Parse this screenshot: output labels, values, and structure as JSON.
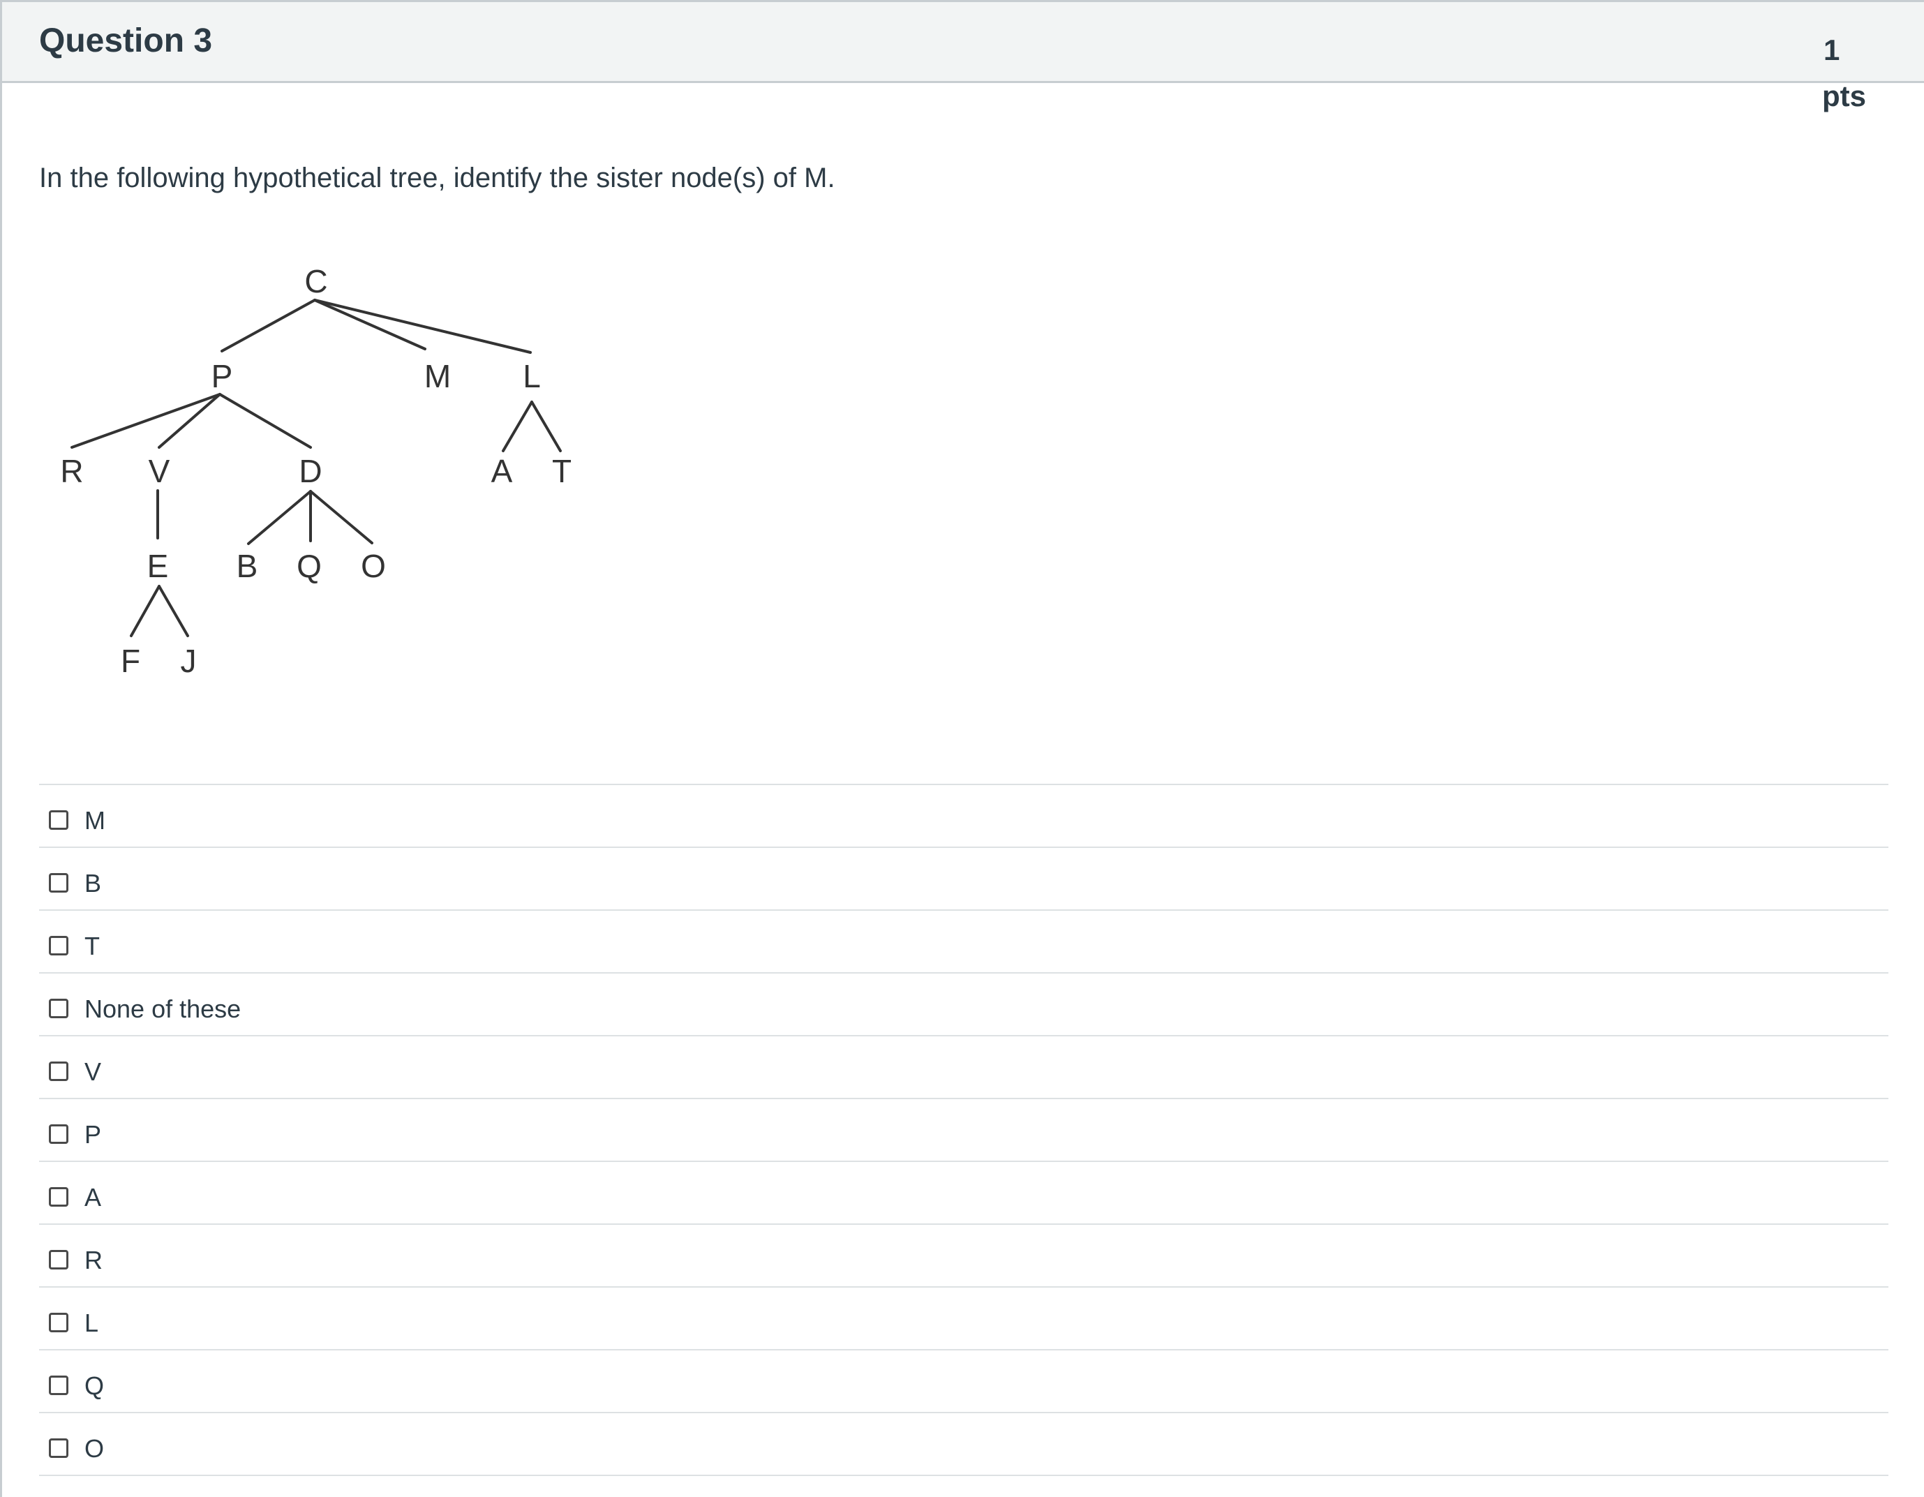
{
  "question": {
    "title": "Question 3",
    "points_value": "1",
    "points_unit": "pts",
    "text": "In the following hypothetical tree, identify the sister node(s) of M."
  },
  "tree": {
    "nodes": [
      "C",
      "P",
      "M",
      "L",
      "R",
      "V",
      "D",
      "A",
      "T",
      "E",
      "B",
      "Q",
      "O",
      "F",
      "J"
    ]
  },
  "answers": [
    {
      "label": "M",
      "checked": false
    },
    {
      "label": "B",
      "checked": false
    },
    {
      "label": "T",
      "checked": false
    },
    {
      "label": "None of these",
      "checked": false
    },
    {
      "label": "V",
      "checked": false
    },
    {
      "label": "P",
      "checked": false
    },
    {
      "label": "A",
      "checked": false
    },
    {
      "label": "R",
      "checked": false
    },
    {
      "label": "L",
      "checked": false
    },
    {
      "label": "Q",
      "checked": false
    },
    {
      "label": "O",
      "checked": false
    }
  ]
}
